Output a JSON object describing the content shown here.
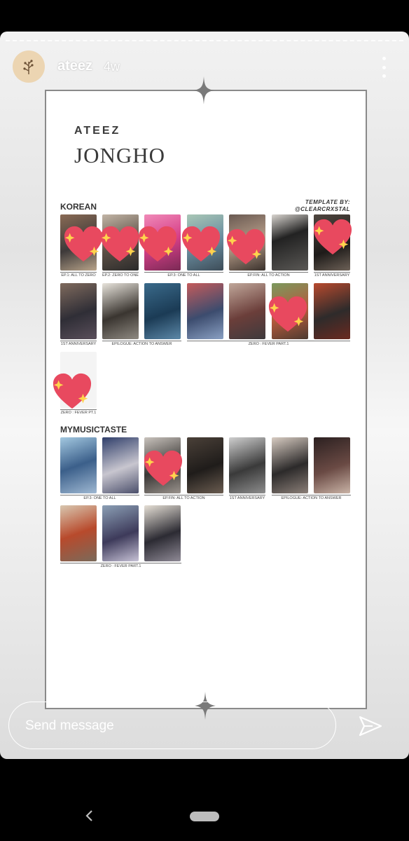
{
  "story": {
    "username": "ateez",
    "time_ago": "4w",
    "more_icon": "more-vertical-icon",
    "avatar_icon": "plant-sprig-icon"
  },
  "template": {
    "brand": "ATEEZ",
    "member": "JONGHO",
    "credit_line1": "TEMPLATE BY:",
    "credit_line2": "@CLEARCRXSTAL",
    "sections": [
      {
        "title": "KOREAN",
        "captions": [
          "EP.1: ALL TO ZERO",
          "EP.2: ZERO TO ONE",
          "EP.3: ONE TO ALL",
          "EP.FIN: ALL TO ACTION",
          "1ST ANNIVERSARY",
          "1ST ANNIVERSARY",
          "EPILOGUE: ACTION TO ANSWER",
          "ZERO : FEVER PART.1",
          "ZERO : FEVER PT.1"
        ],
        "cards": 15
      },
      {
        "title": "MYMUSICTASTE",
        "captions": [
          "EP.3: ONE TO ALL",
          "EP.FIN: ALL TO ACTION",
          "1ST ANNIVERSARY",
          "EPILOGUE: ACTION TO ANSWER",
          "ZERO : FEVER PART.1"
        ],
        "cards": 10
      }
    ],
    "marks": "heart-sticker-icon",
    "accent": "#e8495f"
  },
  "composer": {
    "placeholder": "Send message",
    "send_icon": "send-icon"
  },
  "nav": {
    "back_icon": "back-chevron-icon",
    "home_icon": "home-pill-icon"
  }
}
